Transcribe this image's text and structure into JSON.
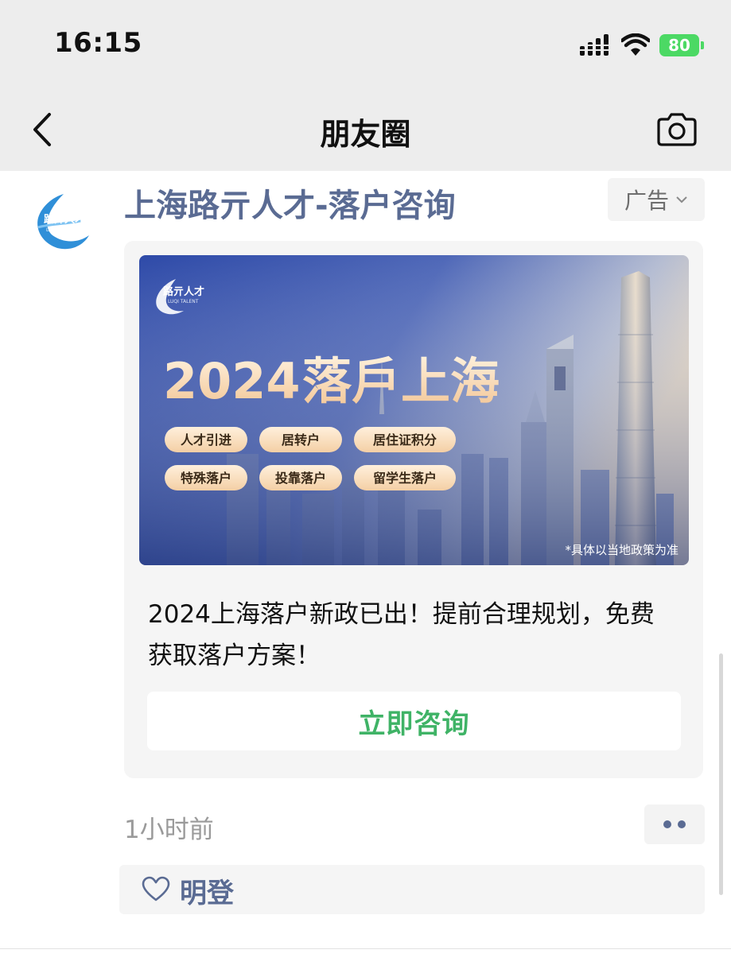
{
  "status_bar": {
    "time": "16:15",
    "battery": "80"
  },
  "nav": {
    "title": "朋友圈",
    "back_icon": "chevron-left-icon",
    "camera_icon": "camera-icon"
  },
  "post": {
    "author": "上海路亓人才-落户咨询",
    "ad_label": "广告",
    "ad_text": "2024上海落户新政已出！提前合理规划，免费获取落户方案！",
    "cta_label": "立即咨询",
    "time_ago": "1小时前",
    "likes": [
      "明登"
    ],
    "avatar_logo": {
      "line1": "路亓人才",
      "line2": "LUQI TALENT"
    }
  },
  "banner": {
    "logo_text": "路亓人才",
    "logo_sub": "LUQI TALENT",
    "headline_year": "2024",
    "headline_text": "落戶上海",
    "tags": [
      "人才引进",
      "居转户",
      "居住证积分",
      "特殊落户",
      "投靠落户",
      "留学生落户"
    ],
    "disclaimer": "*具体以当地政策为准"
  },
  "colors": {
    "accent_link": "#5a6b93",
    "cta_green": "#3fb366",
    "battery_green": "#4cd964"
  }
}
